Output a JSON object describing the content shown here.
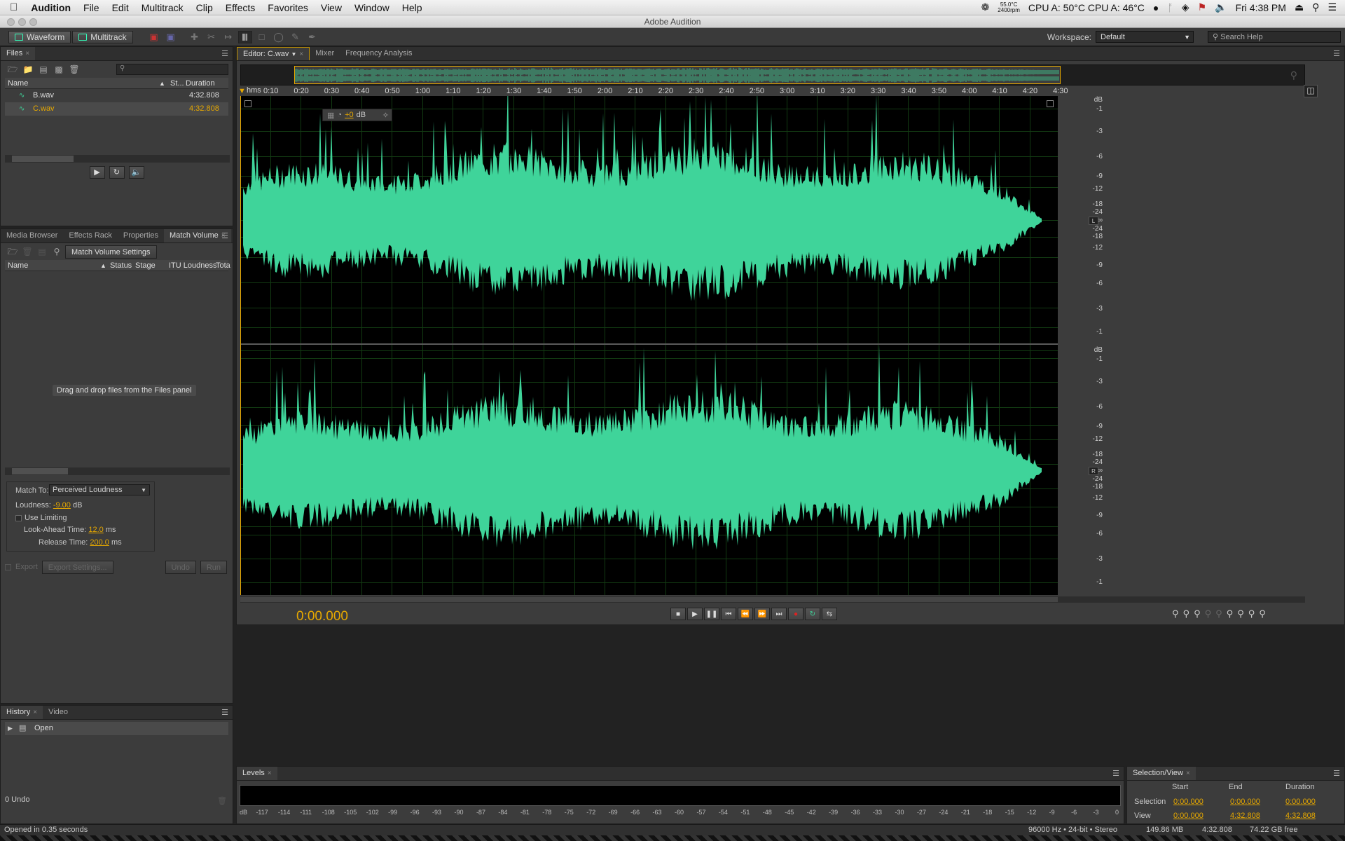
{
  "menubar": {
    "apple": "",
    "app": "Audition",
    "items": [
      "File",
      "Edit",
      "Multitrack",
      "Clip",
      "Effects",
      "Favorites",
      "View",
      "Window",
      "Help"
    ],
    "fan_temp": "55.0°C",
    "fan_rpm": "2400rpm",
    "cpu": "CPU A: 50°C CPU A: 46°C",
    "clock": "Fri 4:38 PM"
  },
  "window": {
    "title": "Adobe Audition"
  },
  "toolbar": {
    "waveform": "Waveform",
    "multitrack": "Multitrack",
    "workspace_label": "Workspace:",
    "workspace_value": "Default",
    "search_placeholder": "Search Help"
  },
  "files_panel": {
    "tab": "Files",
    "col_name": "Name",
    "col_status": "St...",
    "col_duration": "Duration",
    "files": [
      {
        "name": "B.wav",
        "duration": "4:32.808",
        "selected": false
      },
      {
        "name": "C.wav",
        "duration": "4:32.808",
        "selected": true
      }
    ]
  },
  "mv_panel": {
    "tabs": [
      "Media Browser",
      "Effects Rack",
      "Properties",
      "Match Volume"
    ],
    "settings_button": "Match Volume Settings",
    "cols": [
      "Name",
      "Status",
      "Stage",
      "ITU Loudness",
      "Tota"
    ],
    "drop_hint": "Drag and drop files from the Files panel",
    "match_to_label": "Match To:",
    "match_to_value": "Perceived Loudness",
    "loudness_label": "Loudness:",
    "loudness_value": "-9.00",
    "loudness_unit": "dB",
    "use_limiting": "Use Limiting",
    "lookahead_label": "Look-Ahead Time:",
    "lookahead_value": "12.0",
    "lookahead_unit": "ms",
    "release_label": "Release Time:",
    "release_value": "200.0",
    "release_unit": "ms",
    "export": "Export",
    "export_settings": "Export Settings...",
    "undo": "Undo",
    "run": "Run"
  },
  "history_panel": {
    "tabs": [
      "History",
      "Video"
    ],
    "items": [
      "Open"
    ],
    "undo_count": "0 Undo"
  },
  "editor": {
    "tabs": [
      "Editor: C.wav",
      "Mixer",
      "Frequency Analysis"
    ],
    "ruler_unit": "hms",
    "ruler_ticks": [
      "0:10",
      "0:20",
      "0:30",
      "0:40",
      "0:50",
      "1:00",
      "1:10",
      "1:20",
      "1:30",
      "1:40",
      "1:50",
      "2:00",
      "2:10",
      "2:20",
      "2:30",
      "2:40",
      "2:50",
      "3:00",
      "3:10",
      "3:20",
      "3:30",
      "3:40",
      "3:50",
      "4:00",
      "4:10",
      "4:20",
      "4:30"
    ],
    "hud_gain": "+0",
    "hud_unit": "dB",
    "db_scale_top": [
      "dB",
      "-1",
      "-3",
      "-6",
      "-9",
      "-12",
      "-18",
      "-24",
      "-∞",
      "-24",
      "-18",
      "-12",
      "-9",
      "-6",
      "-3",
      "-1"
    ],
    "channel_l": "L",
    "channel_r": "R",
    "time_display": "0:00.000",
    "wave_color": "#3fd49a"
  },
  "levels_panel": {
    "tab": "Levels",
    "scale": [
      "dB",
      "-117",
      "-114",
      "-111",
      "-108",
      "-105",
      "-102",
      "-99",
      "-96",
      "-93",
      "-90",
      "-87",
      "-84",
      "-81",
      "-78",
      "-75",
      "-72",
      "-69",
      "-66",
      "-63",
      "-60",
      "-57",
      "-54",
      "-51",
      "-48",
      "-45",
      "-42",
      "-39",
      "-36",
      "-33",
      "-30",
      "-27",
      "-24",
      "-21",
      "-18",
      "-15",
      "-12",
      "-9",
      "-6",
      "-3",
      "0"
    ]
  },
  "selection_panel": {
    "tab": "Selection/View",
    "col_start": "Start",
    "col_end": "End",
    "col_duration": "Duration",
    "row_selection": "Selection",
    "row_view": "View",
    "sel_start": "0:00.000",
    "sel_end": "0:00.000",
    "sel_duration": "0:00.000",
    "view_start": "0:00.000",
    "view_end": "4:32.808",
    "view_duration": "4:32.808"
  },
  "statusbar": {
    "opened": "Opened in 0.35 seconds",
    "format": "96000 Hz • 24-bit • Stereo",
    "size": "149.86 MB",
    "duration": "4:32.808",
    "free": "74.22 GB free"
  }
}
